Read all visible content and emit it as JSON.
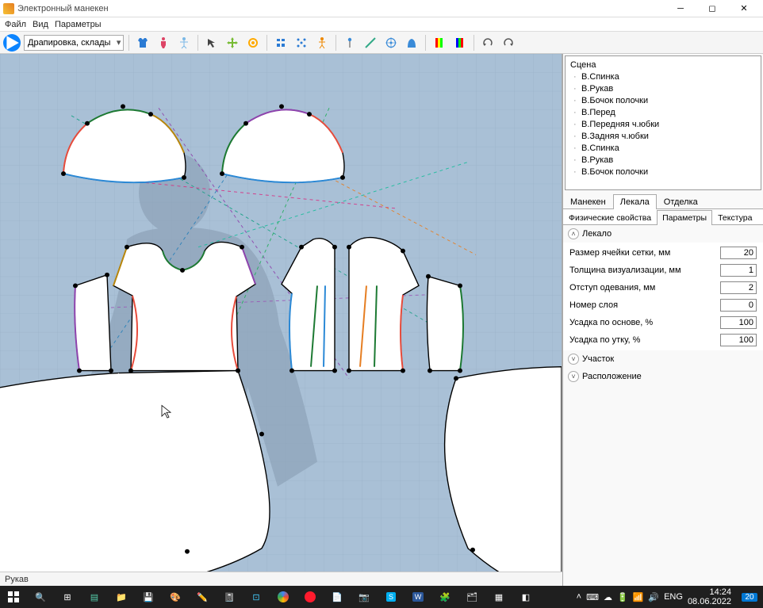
{
  "window": {
    "title": "Электронный манекен"
  },
  "menu": {
    "file": "Файл",
    "view": "Вид",
    "params": "Параметры"
  },
  "toolbar": {
    "mode": "Драпировка, склады"
  },
  "scene": {
    "root": "Сцена",
    "items": [
      "В.Спинка",
      "В.Рукав",
      "В.Бочок полочки",
      "В.Перед",
      "В.Передняя ч.юбки",
      "В.Задняя ч.юбки",
      "В.Спинка",
      "В.Рукав",
      "В.Бочок полочки"
    ]
  },
  "tabs": {
    "main": [
      "Манекен",
      "Лекала",
      "Отделка"
    ],
    "main_active": 1,
    "sub": [
      "Физические свойства",
      "Параметры",
      "Текстура"
    ],
    "sub_active": 1
  },
  "sections": {
    "pattern": {
      "title": "Лекало",
      "rows": [
        {
          "label": "Размер ячейки сетки, мм",
          "value": "20"
        },
        {
          "label": "Толщина визуализации, мм",
          "value": "1"
        },
        {
          "label": "Отступ одевания, мм",
          "value": "2"
        },
        {
          "label": "Номер слоя",
          "value": "0"
        },
        {
          "label": "Усадка по основе, %",
          "value": "100"
        },
        {
          "label": "Усадка по утку, %",
          "value": "100"
        }
      ]
    },
    "area": {
      "title": "Участок"
    },
    "placement": {
      "title": "Расположение"
    }
  },
  "status": {
    "text": "Рукав"
  },
  "taskbar": {
    "lang": "ENG",
    "time": "14:24",
    "date": "08.06.2022",
    "notifications": "20"
  }
}
